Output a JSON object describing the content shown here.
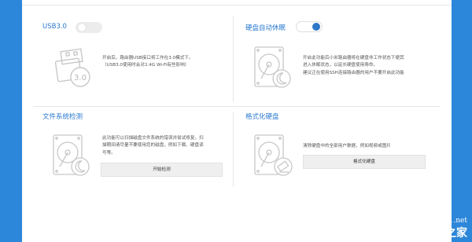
{
  "usb": {
    "title": "USB3.0",
    "enabled": false,
    "desc": [
      "开启后，路由器USB接口将工作在3.0模式下。",
      "（USB3.0使用时会对2.4G Wi-Fi有些影响）"
    ],
    "icon": "usb-drive-icon",
    "badge": "3.0"
  },
  "sleep": {
    "title": "硬盘自动休眠",
    "enabled": true,
    "desc": [
      "开启此功能后小米路由器将在硬盘非工作状态下便其",
      "进入休眠状态，以延长硬盘使用寿命。",
      "建议正在使用SSH连接路由器的用户不要开启此功能"
    ],
    "icon": "hard-drive-sleep-icon"
  },
  "fscheck": {
    "title": "文件系统检测",
    "desc": [
      "此功能可以扫描磁盘文件系统的错误并尝试修复。扫",
      "描期间请尽量不要使用您的磁盘，例如下载、硬盘读",
      "写等。"
    ],
    "button": "开始检测",
    "icon": "hard-drive-check-icon"
  },
  "format": {
    "title": "格式化硬盘",
    "desc": [
      "清除硬盘中的全部用户数据，例如视频或图片"
    ],
    "button": "格式化硬盘",
    "icon": "hard-drive-erase-icon"
  },
  "watermark": {
    "url": "jb51.net",
    "cn": "脚本之家"
  },
  "colors": {
    "accent": "#2a7ad0",
    "background": "#2c86d9",
    "toggle_on": "#2f77c8"
  }
}
